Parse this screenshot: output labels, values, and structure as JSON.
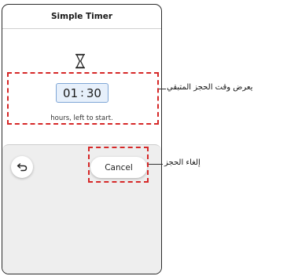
{
  "header": {
    "title": "Simple Timer"
  },
  "timer": {
    "hours": "01",
    "separator": ":",
    "minutes": "30",
    "caption": "hours, left to start."
  },
  "actions": {
    "cancel_label": "Cancel"
  },
  "annotations": {
    "remaining_time": "يعرض وقت الحجز المتبقي",
    "cancel_booking": "إلغاء الحجز"
  },
  "icons": {
    "hourglass": "hourglass-icon",
    "back": "back-arrow-icon"
  },
  "colors": {
    "highlight": "#d62828",
    "time_box_bg": "#e7f0fb",
    "time_box_border": "#7fa6d6"
  }
}
